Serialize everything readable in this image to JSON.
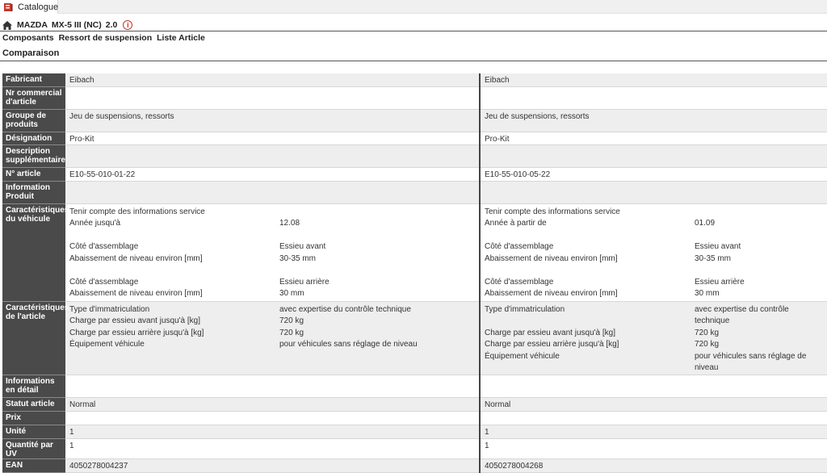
{
  "tab": {
    "label": "Catalogue"
  },
  "vehicle": {
    "make": "MAZDA",
    "model": "MX-5 III (NC)",
    "engine": "2.0",
    "info_symbol": "i"
  },
  "breadcrumb": [
    "Composants",
    "Ressort de suspension",
    "Liste Article"
  ],
  "page_title": "Comparaison",
  "labels": {
    "manufacturer": "Fabricant",
    "commercial_no": "Nr commercial d'article",
    "product_group": "Groupe de produits",
    "designation": "Désignation",
    "extra_description": "Description supplémentaire",
    "article_no": "N° article",
    "product_info": "Information Produit",
    "vehicle_features": "Caractéristiques du véhicule",
    "article_features": "Caractéristiques de l'article",
    "details": "Informations en détail",
    "status": "Statut article",
    "price": "Prix",
    "unit": "Unité",
    "qty": "Quantité par UV",
    "ean": "EAN"
  },
  "products": [
    {
      "manufacturer": "Eibach",
      "product_group": "Jeu de suspensions, ressorts",
      "designation": "Pro-Kit",
      "article_no": "E10-55-010-01-22",
      "vehicle_note": "Tenir compte des informations service",
      "year_key": "Année jusqu'à",
      "year_val": "12.08",
      "side_key": "Côté d'assemblage",
      "side1_val": "Essieu avant",
      "lower_key": "Abaissement de niveau environ [mm]",
      "lower1_val": "30-35 mm",
      "side2_val": "Essieu arrière",
      "lower2_val": "30 mm",
      "reg_key": "Type d'immatriculation",
      "reg_val": "avec expertise du contrôle technique",
      "front_key": "Charge par essieu avant jusqu'à [kg]",
      "front_val": "720 kg",
      "rear_key": "Charge par essieu arrière jusqu'à [kg]",
      "rear_val": "720 kg",
      "equip_key": "Équipement véhicule",
      "equip_val": "pour véhicules sans réglage de niveau",
      "status": "Normal",
      "unit": "1",
      "qty": "1",
      "ean": "4050278004237"
    },
    {
      "manufacturer": "Eibach",
      "product_group": "Jeu de suspensions, ressorts",
      "designation": "Pro-Kit",
      "article_no": "E10-55-010-05-22",
      "vehicle_note": "Tenir compte des informations service",
      "year_key": "Année à partir de",
      "year_val": "01.09",
      "side_key": "Côté d'assemblage",
      "side1_val": "Essieu avant",
      "lower_key": "Abaissement de niveau environ [mm]",
      "lower1_val": "30-35 mm",
      "side2_val": "Essieu arrière",
      "lower2_val": "30 mm",
      "reg_key": "Type d'immatriculation",
      "reg_val": "avec expertise du contrôle technique",
      "front_key": "Charge par essieu avant jusqu'à [kg]",
      "front_val": "720 kg",
      "rear_key": "Charge par essieu arrière jusqu'à [kg]",
      "rear_val": "720 kg",
      "equip_key": "Équipement véhicule",
      "equip_val": "pour véhicules sans réglage de niveau",
      "status": "Normal",
      "unit": "1",
      "qty": "1",
      "ean": "4050278004268"
    }
  ]
}
